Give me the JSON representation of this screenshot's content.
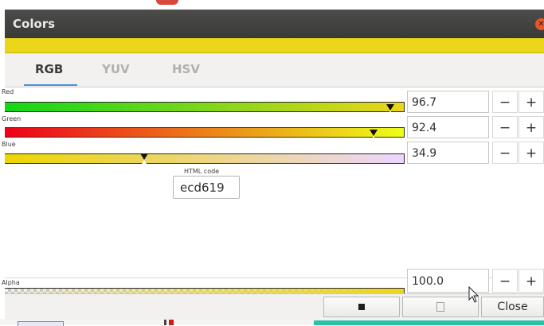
{
  "window": {
    "title": "Colors",
    "preview_color": "#ecd619"
  },
  "tabs": [
    {
      "label": "RGB",
      "active": true
    },
    {
      "label": "YUV",
      "active": false
    },
    {
      "label": "HSV",
      "active": false
    }
  ],
  "channels": {
    "red": {
      "label": "Red",
      "value": "96.7",
      "percent": 96.7
    },
    "green": {
      "label": "Green",
      "value": "92.4",
      "percent": 92.4
    },
    "blue": {
      "label": "Blue",
      "value": "34.9",
      "percent": 34.9
    }
  },
  "html_code": {
    "label": "HTML code",
    "value": "ecd619"
  },
  "alpha": {
    "label": "Alpha",
    "value": "100.0",
    "percent": 100.0
  },
  "stepper": {
    "minus": "−",
    "plus": "+"
  },
  "footer": {
    "close_label": "Close"
  },
  "icons": {
    "close": "close-icon",
    "pick_screen": "stop-icon",
    "copy": "copy-icon"
  }
}
